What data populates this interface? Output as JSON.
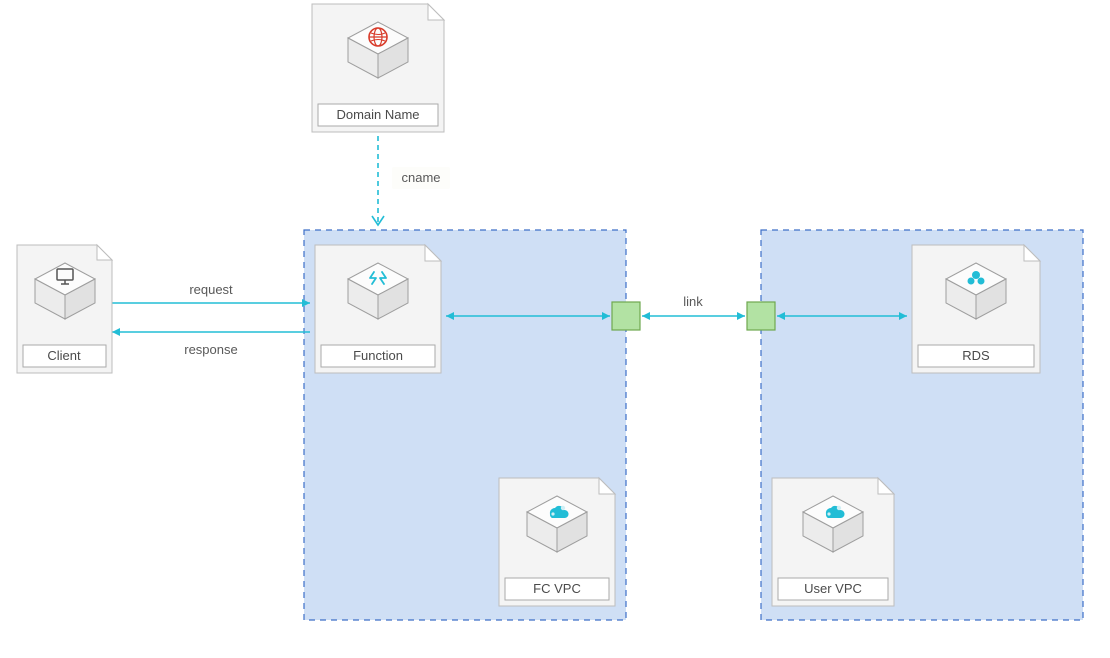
{
  "nodes": {
    "client": {
      "label": "Client"
    },
    "domain": {
      "label": "Domain Name"
    },
    "function": {
      "label": "Function"
    },
    "fcvpc": {
      "label": "FC VPC"
    },
    "uservpc": {
      "label": "User VPC"
    },
    "rds": {
      "label": "RDS"
    }
  },
  "edges": {
    "cname": {
      "label": "cname"
    },
    "request": {
      "label": "request"
    },
    "response": {
      "label": "response"
    },
    "link": {
      "label": "link"
    }
  }
}
